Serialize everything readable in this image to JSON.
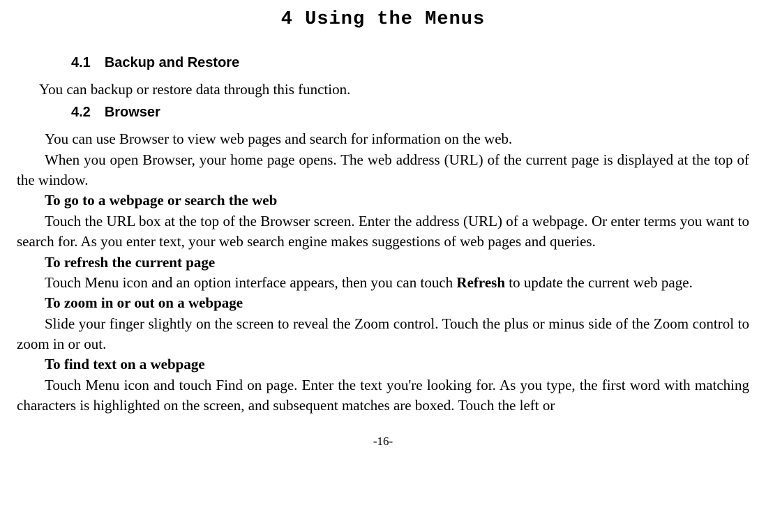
{
  "title": "4 Using the Menus",
  "section41_number": "4.1",
  "section41_label": "Backup and Restore",
  "section41_text": "You can backup or restore data through this function.",
  "section42_number": "4.2",
  "section42_label": "Browser",
  "para1": "You can use Browser to view web pages and search for information on the web.",
  "para2": "When you open Browser, your home page opens. The web address (URL) of the current page is displayed at the top of the window.",
  "sub1": "To go to a webpage or search the web",
  "sub1_text": "Touch the URL box at the top of the Browser screen. Enter the address (URL) of a webpage. Or enter terms you want to search for. As you enter text, your web search engine makes suggestions of web pages and queries.",
  "sub2": "To refresh the current page",
  "sub2_text_before": "Touch Menu icon and an option interface appears, then you can touch ",
  "sub2_bold": "Refresh",
  "sub2_text_after": " to update the current web page.",
  "sub3": "To zoom in or out on a webpage",
  "sub3_text": "Slide your finger slightly on the screen to reveal the Zoom control. Touch the plus or minus side of the Zoom control to zoom in or out.",
  "sub4": "To find text on a webpage",
  "sub4_text": "Touch Menu icon and touch Find on page. Enter the text you're looking for. As you type, the first word with matching characters is highlighted on the screen, and subsequent matches are boxed. Touch the left or",
  "page_number": "-16-"
}
